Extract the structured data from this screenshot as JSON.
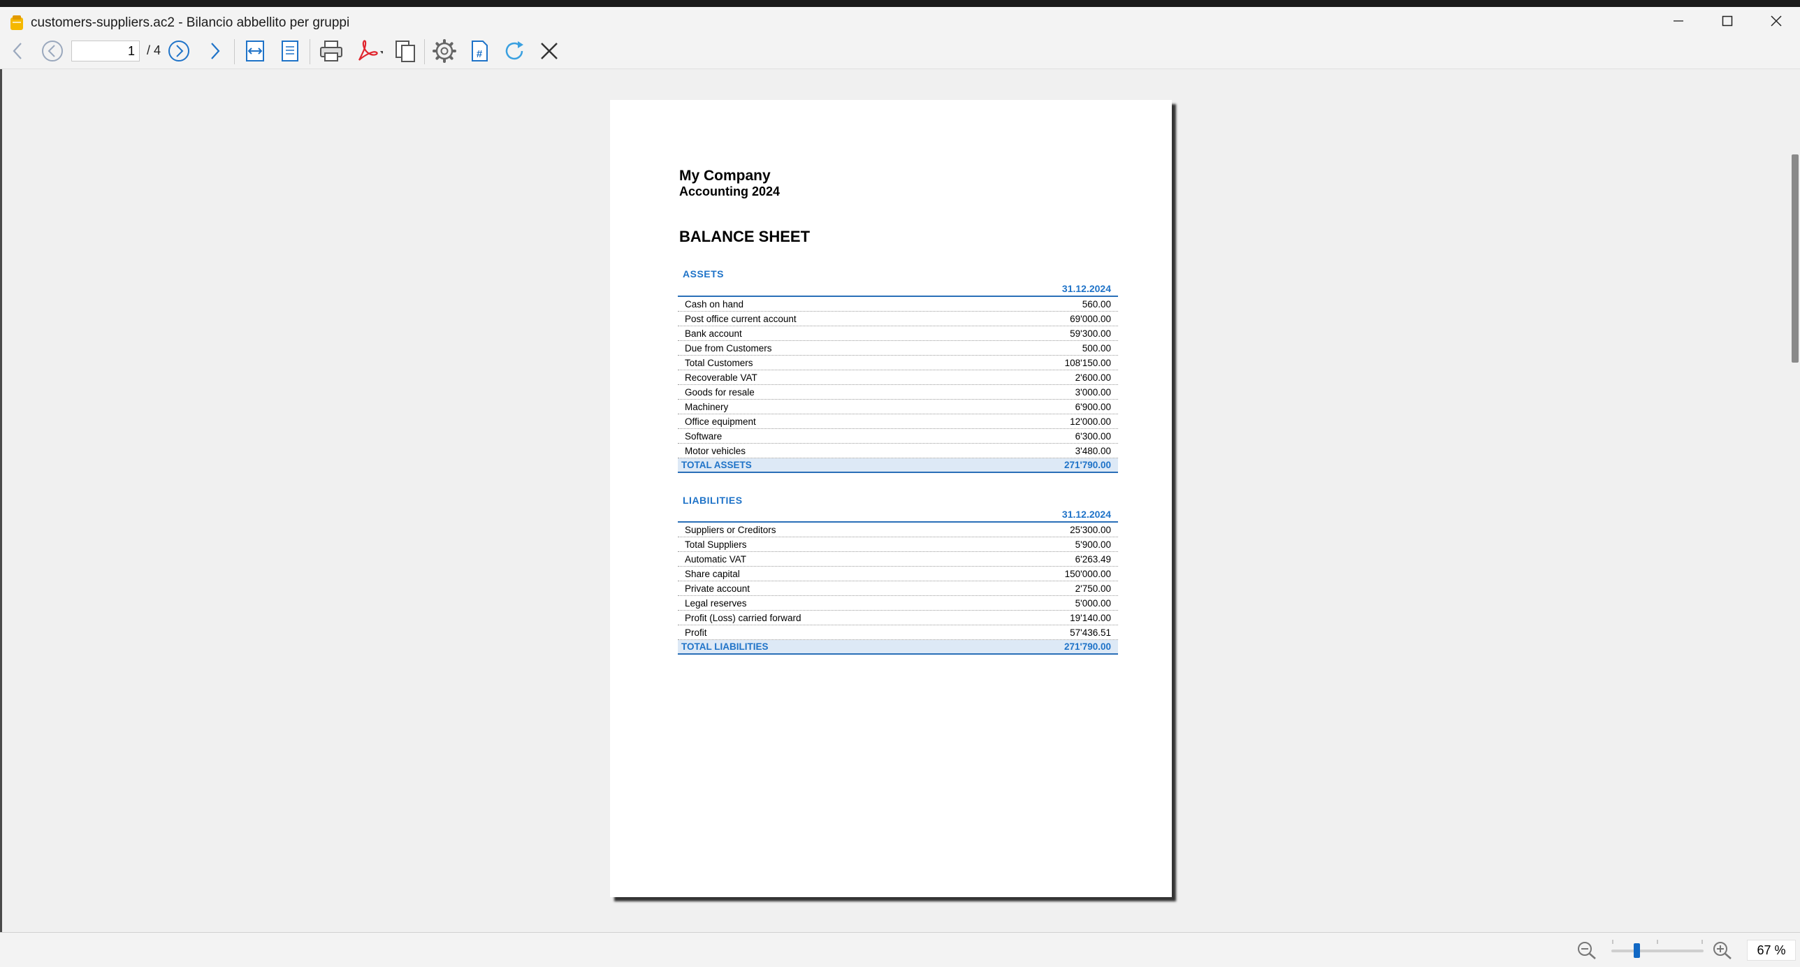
{
  "window": {
    "title": "customers-suppliers.ac2 - Bilancio abbellito per gruppi"
  },
  "toolbar": {
    "page_current": "1",
    "page_total": "/ 4",
    "icons": [
      "back-arrow-icon",
      "previous-page-icon",
      "next-page-icon",
      "forward-arrow-icon",
      "fit-width-icon",
      "fit-page-icon",
      "print-icon",
      "pdf-icon",
      "copy-pages-icon",
      "settings-gear-icon",
      "page-number-icon",
      "refresh-icon",
      "close-icon"
    ],
    "accent": "#1f73c8"
  },
  "report": {
    "company": "My Company",
    "subtitle": "Accounting 2024",
    "title": "BALANCE SHEET",
    "assets": {
      "heading": "ASSETS",
      "date": "31.12.2024",
      "rows": [
        {
          "label": "Cash on hand",
          "amount": "560.00"
        },
        {
          "label": "Post office current account",
          "amount": "69'000.00"
        },
        {
          "label": "Bank account",
          "amount": "59'300.00"
        },
        {
          "label": "Due from Customers",
          "amount": "500.00"
        },
        {
          "label": "Total Customers",
          "amount": "108'150.00"
        },
        {
          "label": "Recoverable VAT",
          "amount": "2'600.00"
        },
        {
          "label": "Goods for resale",
          "amount": "3'000.00"
        },
        {
          "label": "Machinery",
          "amount": "6'900.00"
        },
        {
          "label": "Office equipment",
          "amount": "12'000.00"
        },
        {
          "label": "Software",
          "amount": "6'300.00"
        },
        {
          "label": "Motor vehicles",
          "amount": "3'480.00"
        }
      ],
      "total_label": "TOTAL ASSETS",
      "total_amount": "271'790.00"
    },
    "liabilities": {
      "heading": "LIABILITIES",
      "date": "31.12.2024",
      "rows": [
        {
          "label": "Suppliers or Creditors",
          "amount": "25'300.00"
        },
        {
          "label": "Total Suppliers",
          "amount": "5'900.00"
        },
        {
          "label": "Automatic VAT",
          "amount": "6'263.49"
        },
        {
          "label": "Share capital",
          "amount": "150'000.00"
        },
        {
          "label": "Private account",
          "amount": "2'750.00"
        },
        {
          "label": "Legal reserves",
          "amount": "5'000.00"
        },
        {
          "label": "Profit (Loss) carried forward",
          "amount": "19'140.00"
        },
        {
          "label": "Profit",
          "amount": "57'436.51"
        }
      ],
      "total_label": "TOTAL LIABILITIES",
      "total_amount": "271'790.00"
    }
  },
  "statusbar": {
    "zoom_value": "67 %",
    "zoom_slider_fraction": 0.2
  }
}
